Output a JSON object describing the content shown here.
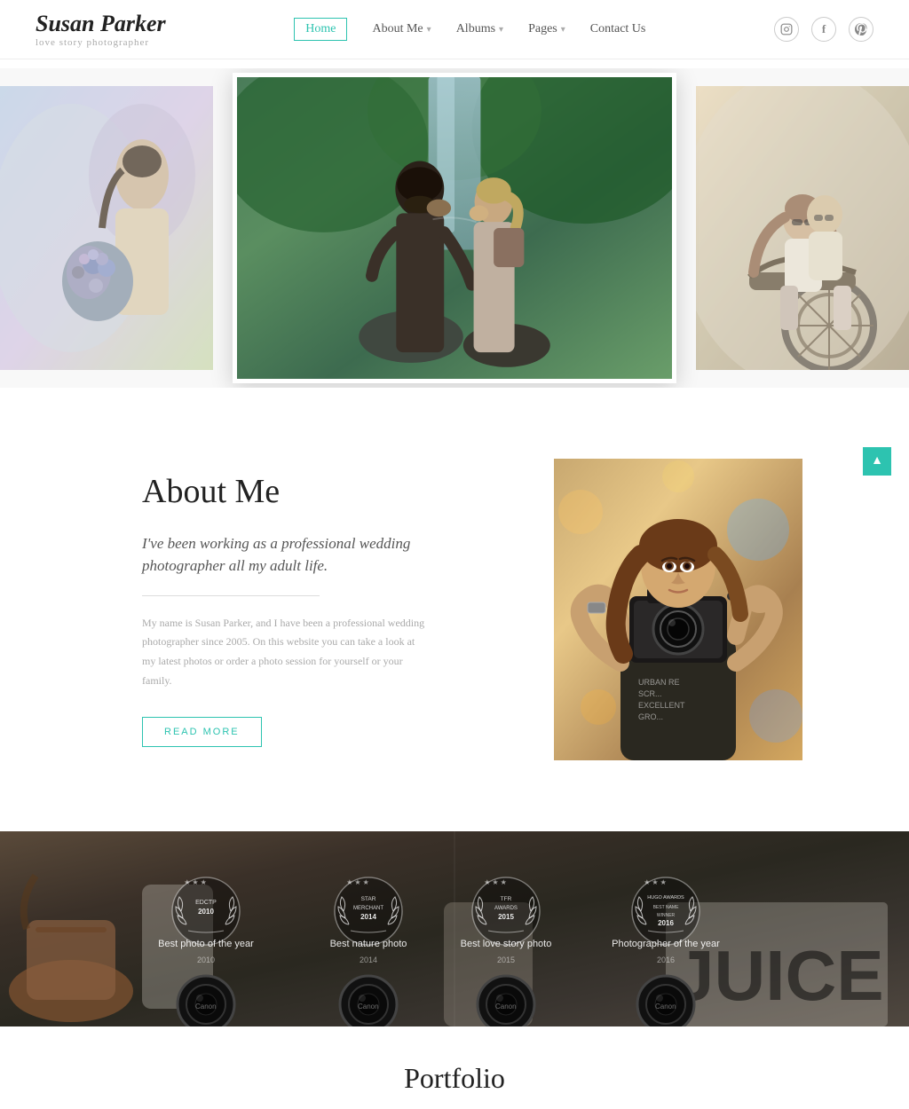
{
  "site": {
    "name": "Susan Parker",
    "tagline": "love story photographer"
  },
  "nav": {
    "links": [
      {
        "id": "home",
        "label": "Home",
        "active": true,
        "hasDropdown": false
      },
      {
        "id": "about",
        "label": "About Me",
        "active": false,
        "hasDropdown": true
      },
      {
        "id": "albums",
        "label": "Albums",
        "active": false,
        "hasDropdown": true
      },
      {
        "id": "pages",
        "label": "Pages",
        "active": false,
        "hasDropdown": true
      },
      {
        "id": "contact",
        "label": "Contact Us",
        "active": false,
        "hasDropdown": false
      }
    ],
    "social": [
      {
        "id": "instagram",
        "icon": "⊡"
      },
      {
        "id": "facebook",
        "icon": "f"
      },
      {
        "id": "pinterest",
        "icon": "P"
      }
    ]
  },
  "about": {
    "title": "About Me",
    "tagline": "I've been working as a professional wedding photographer all my adult life.",
    "body": "My name is Susan Parker, and I have been a professional wedding photographer since 2005. On this website you can take a look at my latest photos or order a photo session for yourself or your family.",
    "read_more": "READ MORE"
  },
  "awards": [
    {
      "id": "award1",
      "badge_text": "EDCTP\n2010",
      "title": "Best photo of the year",
      "year": "2010"
    },
    {
      "id": "award2",
      "badge_text": "STAR\nMERCHANT\n2014",
      "title": "Best nature photo",
      "year": "2014"
    },
    {
      "id": "award3",
      "badge_text": "TFR\nAWARDS\n2015",
      "title": "Best love story photo",
      "year": "2015"
    },
    {
      "id": "award4",
      "badge_text": "HUGO\nAWARDS\n2016",
      "title": "Photographer of the year",
      "year": "2016"
    }
  ],
  "portfolio": {
    "section_hint": "Portfolio"
  },
  "ui": {
    "back_to_top": "▲",
    "accent_color": "#2dc3b0"
  }
}
